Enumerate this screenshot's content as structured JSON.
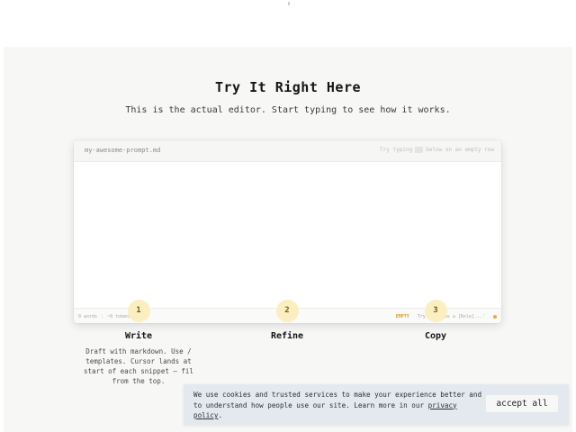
{
  "section": {
    "title": "Try It Right Here",
    "subtitle": "This is the actual editor. Start typing to see how it works."
  },
  "editor": {
    "filename": "my-awesome-prompt.md",
    "hint_prefix": "Try typing",
    "hint_suffix": "below on an empty row",
    "content": "",
    "footer": {
      "words": "0 words",
      "tokens": "~0 tokens",
      "status": "EMPTY",
      "suggestion": "Try: 'Act as a [Role]...'"
    }
  },
  "steps": [
    {
      "number": "1",
      "title": "Write",
      "desc": "Draft with markdown. Use / templates. Cursor lands at start of each snippet — fil from the top."
    },
    {
      "number": "2",
      "title": "Refine",
      "desc": ""
    },
    {
      "number": "3",
      "title": "Copy",
      "desc": ""
    }
  ],
  "cookie": {
    "text": "We use cookies and trusted services to make your experience better and to understand how people use our site. Learn more in our",
    "link": "privacy policy",
    "end": ".",
    "button": "accept all"
  },
  "colors": {
    "accent": "#fbeec0",
    "status": "#d69a2a",
    "banner": "#e4e9ef"
  }
}
